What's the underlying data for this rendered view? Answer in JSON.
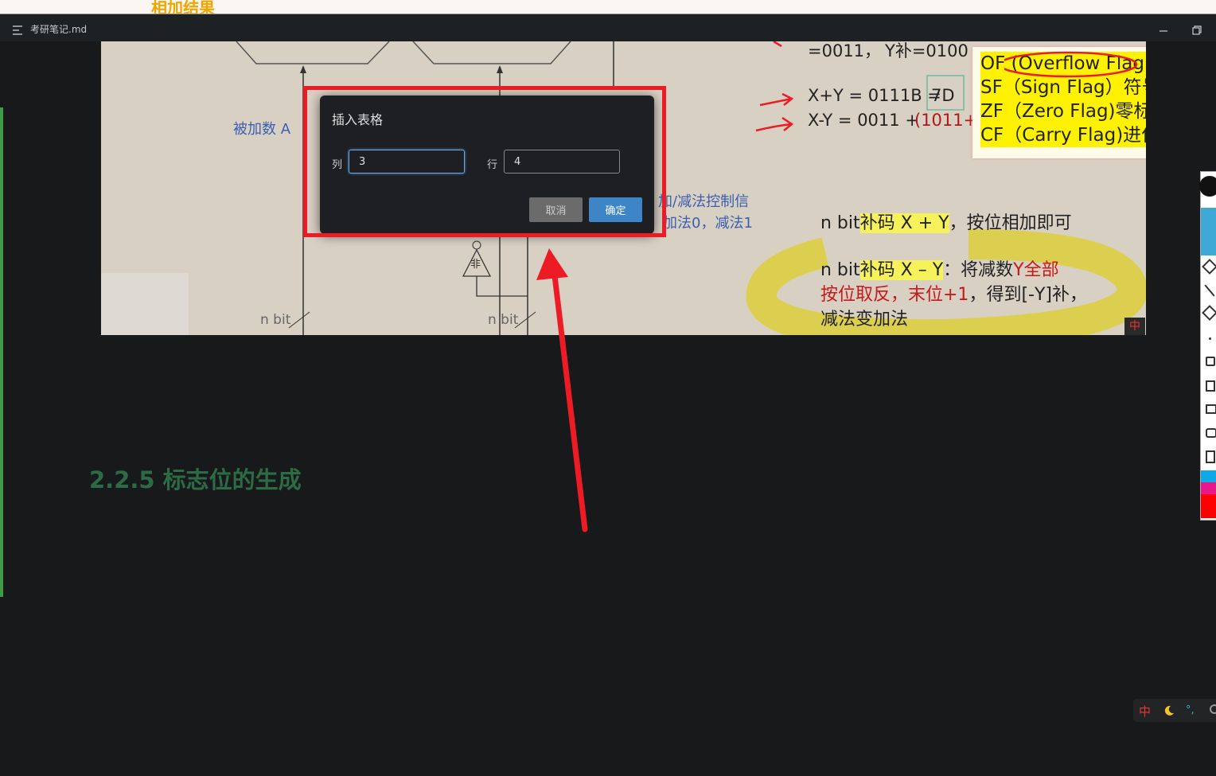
{
  "top_strip": {
    "text": "相加结果"
  },
  "window": {
    "filename": "考研笔记.md"
  },
  "image": {
    "labels": {
      "augend": "被加数 A",
      "nbit_top": "n bit",
      "nbit_left": "n bit",
      "nbit_right": "n bit",
      "not_gate": "非",
      "ctrl1": "加/减法控制信",
      "ctrl2": "加法0，减法1",
      "line1": "=0011，",
      "line1b": "Y补=0100",
      "sum_eq": "X+Y = 0111B =",
      "sum_hex": "7D",
      "diff_eq": "X-Y = 0011 +",
      "diff_red": "(1011+",
      "add_note_prefix": "n bit",
      "add_note_hl": "补码 X + Y",
      "add_note_rest": "，按位相加即可",
      "sub_note_prefix": "n bit",
      "sub_note_hl": "补码 X – Y",
      "sub_note_rest": "：将减数",
      "sub_note_red": "Y全部",
      "sub_note_line2_red": "按位取反，末位+1",
      "sub_note_line2_rest": "，得到[-Y]补，",
      "sub_note_line3": "减法变加法",
      "ime_badge": "中"
    },
    "flags": [
      {
        "abbr": "OF",
        "text": "(Overflow Flag)溢出"
      },
      {
        "abbr": "SF",
        "text": "（Sign Flag）符号标志"
      },
      {
        "abbr": "ZF",
        "text": "（Zero Flag)零标志，"
      },
      {
        "abbr": "CF",
        "text": "（Carry Flag)进位/借位"
      }
    ]
  },
  "dialog": {
    "title": "插入表格",
    "col_label": "列",
    "col_value": "3",
    "row_label": "行",
    "row_value": "4",
    "cancel": "取消",
    "confirm": "确定"
  },
  "heading": "2.2.5 标志位的生成",
  "ime_bar": {
    "mode": "中"
  },
  "colors": {
    "annotation_red": "#ed1c24",
    "heading_green": "#2d6b44",
    "confirm_blue": "#3d85c6"
  }
}
